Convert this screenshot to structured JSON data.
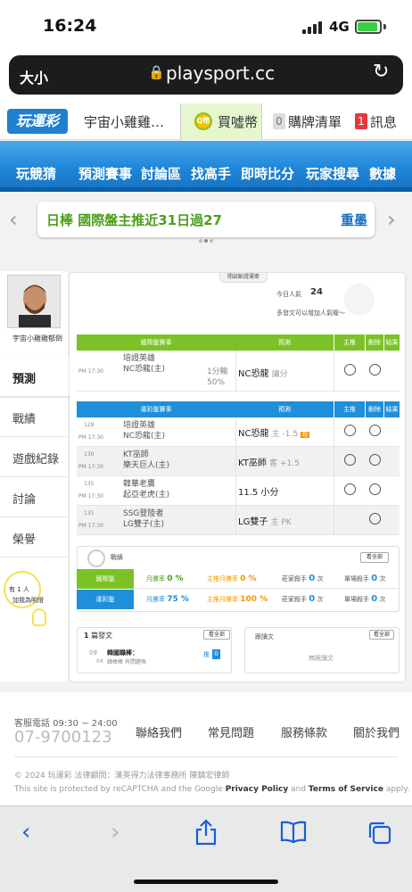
{
  "status_bar": {
    "time": "16:24",
    "network": "4G"
  },
  "url_bar": {
    "text_size_label": "大小",
    "url": "playsport.cc"
  },
  "site_nav": {
    "logo": "玩運彩",
    "user": "宇宙小雞雞…",
    "coin_icon": "Q幣",
    "coin_label": "買噓幣",
    "cart_count": "0",
    "cart_label": "購牌清單",
    "msg_count": "1",
    "msg_label": "訊息"
  },
  "menu": {
    "items": [
      "玩競猜",
      "預測賽事",
      "討論區",
      "找高手",
      "即時比分",
      "玩家搜尋",
      "數據"
    ]
  },
  "ticker": {
    "text": "日棒 國際盤主推近31日過27",
    "team": "重墨"
  },
  "sidebar": {
    "username": "宇宙小雞雞郁倒",
    "items": [
      "預測",
      "戰績",
      "遊戲紀錄",
      "討論",
      "榮譽"
    ],
    "fans_line1": "有 1 人",
    "fans_line2": "加我為明燈"
  },
  "main": {
    "tab_label": "開啟斷證運牽",
    "popularity_label": "今日人氣",
    "popularity_value": "24",
    "popularity_note": "多發文可以增加人氣喔～",
    "intl": {
      "headers": [
        "國際盤賽事",
        "預測",
        "主推",
        "刪除",
        "結果"
      ],
      "rows": [
        {
          "time": "PM 17:30",
          "team1": "培證英雄",
          "team2": "NC恐龍(主)",
          "odds_note1": "1分輸",
          "odds_note2": "50%",
          "pick": "NC恐龍",
          "pick_detail": "讓分"
        }
      ]
    },
    "sports": {
      "headers": [
        "運彩盤賽事",
        "預測",
        "主推",
        "刪除",
        "結果"
      ],
      "rows": [
        {
          "num": "129",
          "time": "PM 17:30",
          "team1": "培證英雄",
          "team2": "NC恐龍(主)",
          "pick": "NC恐龍",
          "pick_detail": "主 -1.5",
          "badge": "殺"
        },
        {
          "num": "130",
          "time": "PM 17:30",
          "team1": "KT巫師",
          "team2": "樂天巨人(主)",
          "pick": "KT巫師",
          "pick_detail": "客 +1.5",
          "badge": ""
        },
        {
          "num": "135",
          "time": "PM 17:30",
          "team1": "韓華老鷹",
          "team2": "起亞老虎(主)",
          "pick": "11.5 小分",
          "pick_detail": "",
          "badge": ""
        },
        {
          "num": "131",
          "time": "PM 17:30",
          "team1": "SSG登陸者",
          "team2": "LG雙子(主)",
          "pick": "LG雙子",
          "pick_detail": "主 PK",
          "badge": ""
        }
      ]
    },
    "stats": {
      "label": "戰績",
      "view_all": "看全部",
      "rows": [
        {
          "name": "國際盤",
          "month_rate_label": "月勝率",
          "month_rate": "0 %",
          "main_rate_label": "主推月勝率",
          "main_rate": "0 %",
          "killer_label": "莊家殺手",
          "killer": "0",
          "killer_unit": "次",
          "single_label": "單場殺手",
          "single": "0",
          "single_unit": "次"
        },
        {
          "name": "運彩盤",
          "month_rate_label": "月勝率",
          "month_rate": "75 %",
          "main_rate_label": "主推月勝率",
          "main_rate": "100 %",
          "killer_label": "莊家殺手",
          "killer": "0",
          "killer_unit": "次",
          "single_label": "單場殺手",
          "single": "0",
          "single_unit": "次"
        }
      ]
    },
    "posts": {
      "count": "1",
      "label": "篇發文",
      "view_all": "看全部",
      "date_month": "09",
      "date_day": "04",
      "title": "韓國職棒：",
      "subtitle": "韓棒棒 有問題嗎",
      "tag": "推",
      "tag_count": "0"
    },
    "replies": {
      "label": "跟讀文",
      "view_all": "看全部",
      "empty": "無跟讀文"
    }
  },
  "footer": {
    "service_label": "客服電話 09:30 ~ 24:00",
    "phone": "07-9700123",
    "links": [
      "聯絡我們",
      "常見問題",
      "服務條款",
      "關於我們"
    ],
    "copyright": "© 2024 玩運彩 法律顧問：漢英得力法律事務所 陳鎮宏律師",
    "captcha_prefix": "This site is protected by reCAPTCHA and the Google",
    "privacy": "Privacy Policy",
    "and": "and",
    "terms": "Terms of Service",
    "apply": "apply."
  },
  "colors": {
    "green": "#8dc21f",
    "blue": "#1e8fd8",
    "orange": "#f39800",
    "red": "#e0393e"
  }
}
